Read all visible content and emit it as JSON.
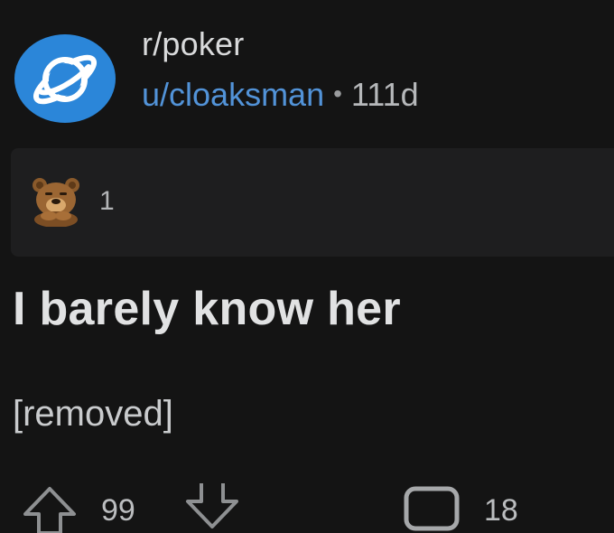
{
  "post": {
    "subreddit": "r/poker",
    "username": "u/cloaksman",
    "separator": "•",
    "age": "111d",
    "title": "I barely know her",
    "body": "[removed]"
  },
  "awards": {
    "icon": "bear-award-icon",
    "count": "1"
  },
  "actions": {
    "score": "99",
    "comments": "18"
  },
  "colors": {
    "background": "#141414",
    "avatar": "#2b86d9",
    "username": "#5293d8",
    "award_box": "#1e1e1f"
  }
}
